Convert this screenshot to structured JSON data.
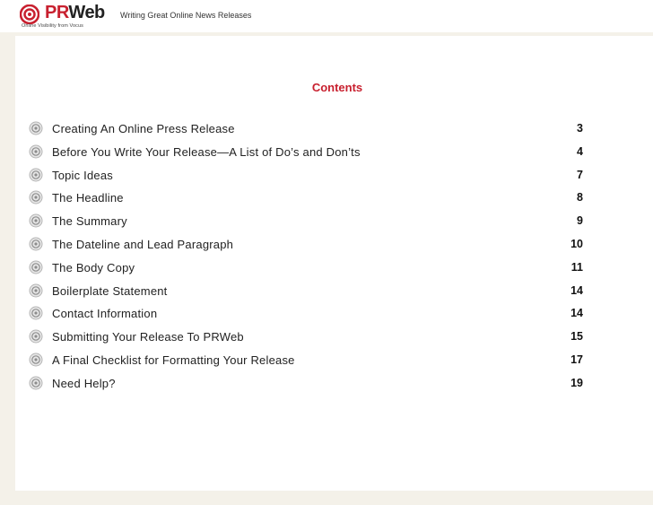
{
  "header": {
    "logo_pr": "PR",
    "logo_web": "Web",
    "logo_tagline": "Online Visibility from Vocus",
    "title": "Writing Great Online News Releases"
  },
  "contents": {
    "heading": "Contents",
    "items": [
      {
        "label": "Creating An Online Press Release",
        "page": "3"
      },
      {
        "label": "Before You Write Your Release—A List of Do’s and Don’ts",
        "page": "4"
      },
      {
        "label": "Topic Ideas",
        "page": "7"
      },
      {
        "label": "The Headline",
        "page": "8"
      },
      {
        "label": "The Summary",
        "page": "9"
      },
      {
        "label": "The Dateline and Lead Paragraph",
        "page": "10"
      },
      {
        "label": "The Body Copy",
        "page": "11"
      },
      {
        "label": "Boilerplate Statement",
        "page": "14"
      },
      {
        "label": "Contact Information",
        "page": "14"
      },
      {
        "label": "Submitting Your Release To PRWeb",
        "page": "15"
      },
      {
        "label": "A Final Checklist for Formatting Your Release",
        "page": "17"
      },
      {
        "label": "Need Help?",
        "page": "19"
      }
    ]
  },
  "colors": {
    "accent": "#c8202f",
    "background": "#f4f1e9",
    "page": "#ffffff"
  }
}
